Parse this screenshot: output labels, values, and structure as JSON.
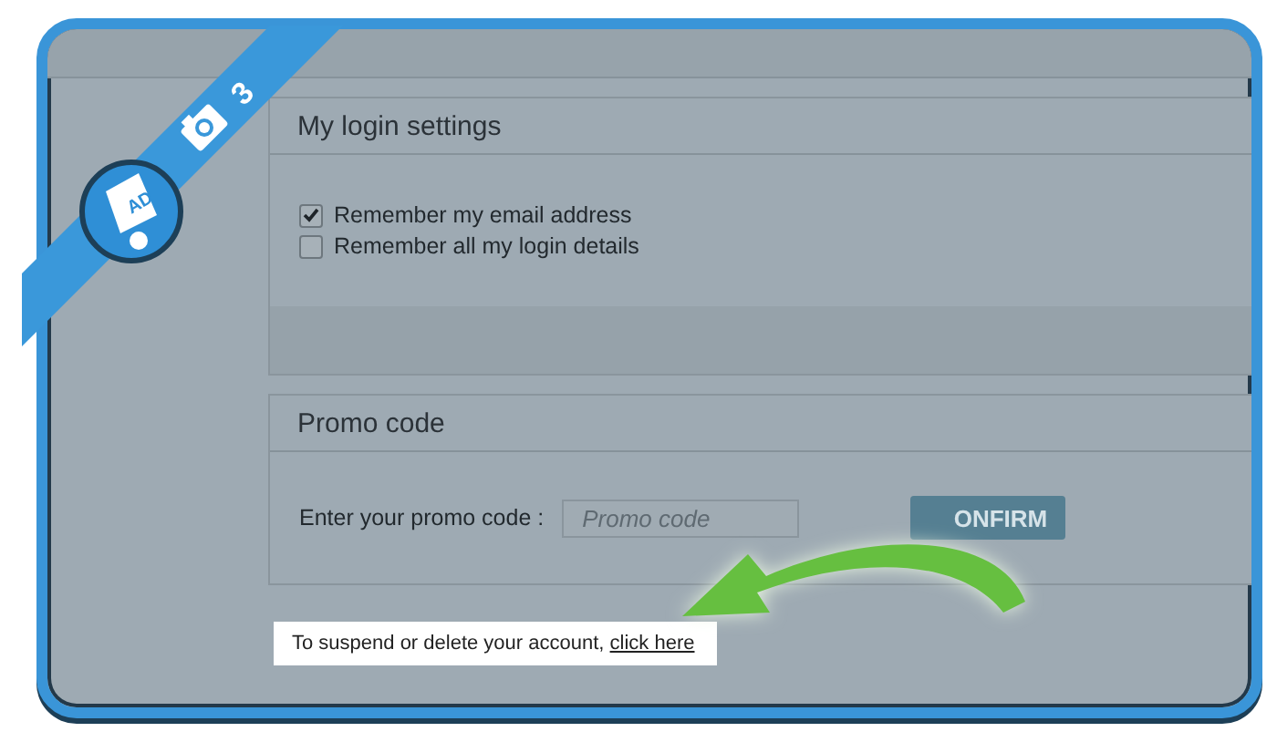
{
  "ribbon": {
    "step": "3",
    "logo": "AD"
  },
  "login_settings": {
    "title": "My login settings",
    "options": [
      {
        "label": "Remember my email address",
        "checked": true
      },
      {
        "label": "Remember all my login details",
        "checked": false
      }
    ]
  },
  "promo": {
    "title": "Promo code",
    "label": "Enter your promo code :",
    "placeholder": "Promo code",
    "button": "ONFIRM"
  },
  "footer": {
    "text": "To suspend or delete your account, ",
    "link": "click here"
  }
}
